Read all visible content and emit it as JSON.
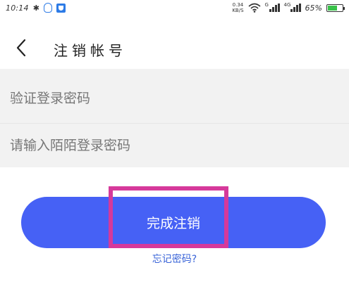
{
  "status_bar": {
    "time": "10:14",
    "bluetooth_icon": "bluetooth-icon",
    "net_speed_value": "0.34",
    "net_speed_unit": "KB/S",
    "sim1_tag": "G",
    "sim2_tag": "4G",
    "battery_percent": "65%",
    "battery_level": 0.65,
    "battery_color": "#39c24a"
  },
  "header": {
    "back_icon": "chevron-left-icon",
    "title": "注销帐号"
  },
  "form": {
    "section_title": "验证登录密码",
    "password_placeholder": "请输入陌陌登录密码",
    "password_value": ""
  },
  "actions": {
    "complete_label": "完成注销",
    "forgot_label": "忘记密码?"
  },
  "colors": {
    "accent": "#4661f5",
    "highlight_border": "#d6399b",
    "link": "#3a64d8",
    "band_bg": "#f2f2f2"
  }
}
